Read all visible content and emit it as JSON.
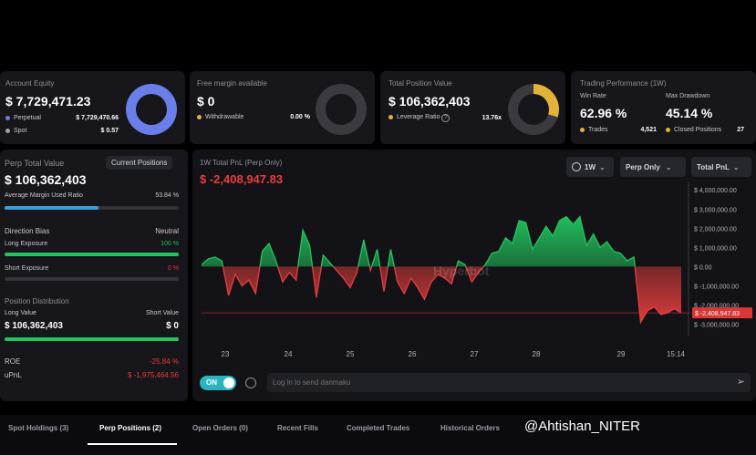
{
  "equity": {
    "label": "Account Equity",
    "value": "$ 7,729,471.23",
    "rows": [
      {
        "name": "Perpetual",
        "value": "$ 7,729,470.66",
        "color": "#6a7ee8"
      },
      {
        "name": "Spot",
        "value": "$ 0.57",
        "color": "#a2a2ad"
      }
    ]
  },
  "free_margin": {
    "label": "Free margin available",
    "value": "$ 0",
    "row_name": "Withdrawable",
    "row_value": "0.00 %",
    "color": "#e2b23a"
  },
  "position_value": {
    "label": "Total Position Value",
    "value": "$ 106,362,403",
    "row_name": "Leverage Ratio",
    "row_value": "13.76x",
    "help": "?",
    "color": "#e2b23a"
  },
  "performance": {
    "label": "Trading Performance (1W)",
    "win_rate_label": "Win Rate",
    "win_rate": "62.96 %",
    "drawdown_label": "Max Drawdown",
    "drawdown": "45.14 %",
    "trades_label": "Trades",
    "trades": "4,521",
    "closed_label": "Closed Positions",
    "closed": "27",
    "color": "#e2b23a"
  },
  "perp": {
    "label": "Perp Total Value",
    "positions_button": "Current Positions",
    "value": "$ 106,362,403",
    "avg_margin_label": "Average Margin Used Ratio",
    "avg_margin_value": "53.84 %",
    "avg_margin_pct": 53.84,
    "direction_label": "Direction Bias",
    "direction_value": "Neutral",
    "long_label": "Long Exposure",
    "long_value": "100 %",
    "long_pct": 100,
    "short_label": "Short Exposure",
    "short_value": "0 %",
    "short_pct": 0,
    "distribution_label": "Position Distribution",
    "long_value_label": "Long Value",
    "short_value_label": "Short Value",
    "long_dist": "$ 106,362,403",
    "short_dist": "$ 0",
    "long_dist_pct": 100,
    "roe_label": "ROE",
    "roe": "-25.84 %",
    "upnl_label": "uPnL",
    "upnl": "$ -1,975,464.56"
  },
  "chart_panel": {
    "title": "1W Total PnL (Perp Only)",
    "current": "$ -2,408,947.83",
    "timeframe": "1W",
    "filter": "Perp Only",
    "metric": "Total PnL",
    "watermark": "Hyperbot",
    "toggle": "ON",
    "danmaku_placeholder": "Log in to send danmaku"
  },
  "tabs": [
    "Spot Holdings (3)",
    "Perp Positions (2)",
    "Open Orders (0)",
    "Recent Fills",
    "Completed Trades",
    "Historical Orders"
  ],
  "watermark_text": "@Ahtishan_NITER",
  "chart_data": {
    "type": "line",
    "x_ticks": [
      "23",
      "24",
      "25",
      "26",
      "27",
      "28",
      "29",
      "15:14"
    ],
    "y_ticks": [
      "$ 4,000,000.00",
      "$ 3,000,000.00",
      "$ 2,000,000.00",
      "$ 1,000,000.00",
      "$ 0.00",
      "$ -1,000,000.00",
      "$ -2,000,000.00",
      "$ -3,000,000.00"
    ],
    "ylim": [
      -3400000,
      4200000
    ],
    "values": [
      100000,
      400000,
      500000,
      300000,
      -1500000,
      -400000,
      -1000000,
      -700000,
      -1400000,
      800000,
      1200000,
      300000,
      -800000,
      -300000,
      -700000,
      1900000,
      1100000,
      -1600000,
      600000,
      200000,
      -200000,
      -600000,
      -1100000,
      -300000,
      1400000,
      -200000,
      900000,
      -1300000,
      900000,
      -800000,
      -1400000,
      -600000,
      -1100000,
      -1700000,
      -800000,
      -400000,
      -600000,
      -900000,
      300000,
      100000,
      -800000,
      -300000,
      100000,
      700000,
      800000,
      1500000,
      1200000,
      2400000,
      2300000,
      900000,
      1500000,
      2100000,
      1600000,
      2400000,
      2600000,
      2200000,
      2600000,
      1100000,
      1700000,
      1000000,
      1300000,
      800000,
      700000,
      300000,
      500000,
      -2900000,
      -2300000,
      -2100000,
      -2500000,
      -2400000,
      -2200000,
      -2408947.83
    ],
    "last_value_label": "$ -2,408,947.83",
    "zero_line": 0,
    "grid": false,
    "up_color": "#22c55e",
    "down_color": "#e53e3e"
  }
}
